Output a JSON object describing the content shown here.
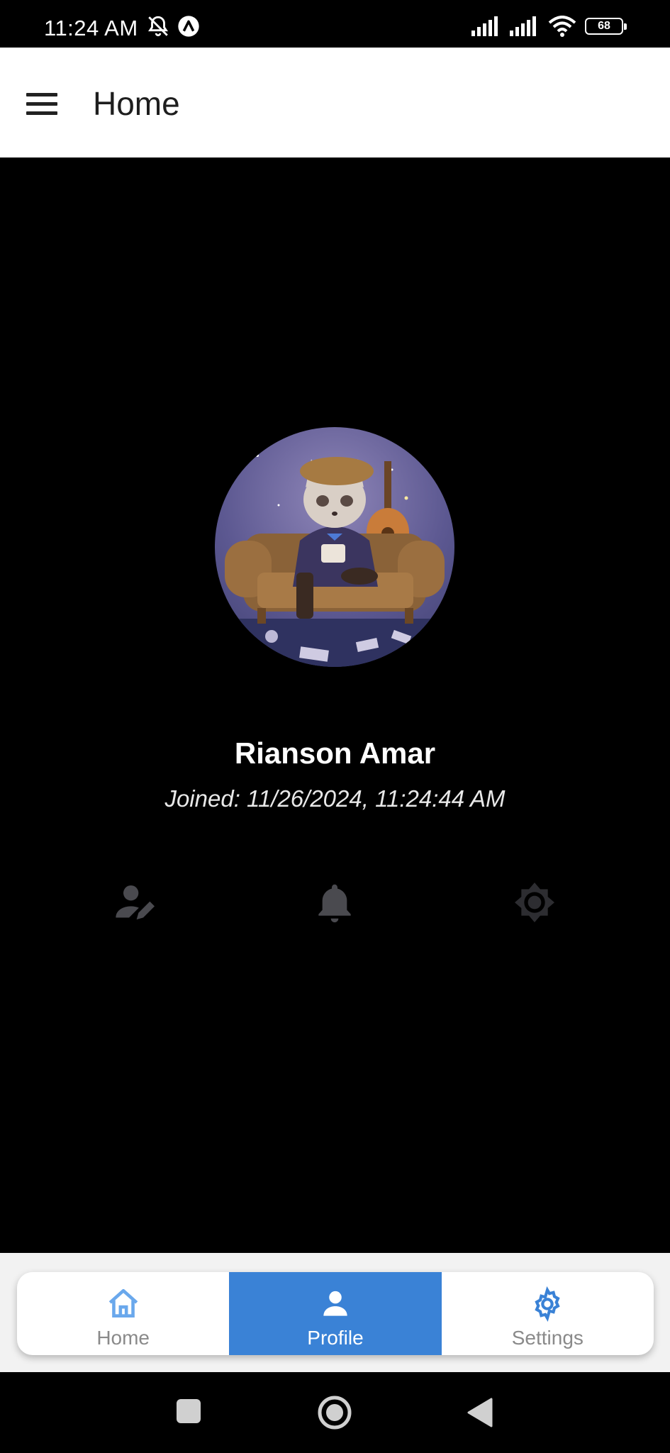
{
  "status_bar": {
    "time": "11:24 AM",
    "icons": [
      "bell-off-icon",
      "app-notification-icon",
      "signal-icon",
      "signal-icon",
      "wifi-icon",
      "battery-icon"
    ],
    "battery_level": "68"
  },
  "app_bar": {
    "title": "Home",
    "menu_icon": "hamburger-menu-icon"
  },
  "profile": {
    "name": "Rianson Amar",
    "joined": "Joined: 11/26/2024, 11:24:44 AM",
    "avatar": "avatar-illustration"
  },
  "actions": [
    {
      "icon": "edit-profile-icon"
    },
    {
      "icon": "notifications-bell-icon"
    },
    {
      "icon": "brightness-icon"
    }
  ],
  "bottom_nav": {
    "items": [
      {
        "label": "Home",
        "icon": "home-icon",
        "active": false
      },
      {
        "label": "Profile",
        "icon": "person-icon",
        "active": true
      },
      {
        "label": "Settings",
        "icon": "gear-icon",
        "active": false
      }
    ],
    "accent_color": "#3a82d6",
    "inactive_icon_color": "#6aa8ec"
  },
  "system_nav": {
    "icons": [
      "recents-square-icon",
      "home-circle-icon",
      "back-triangle-icon"
    ]
  }
}
